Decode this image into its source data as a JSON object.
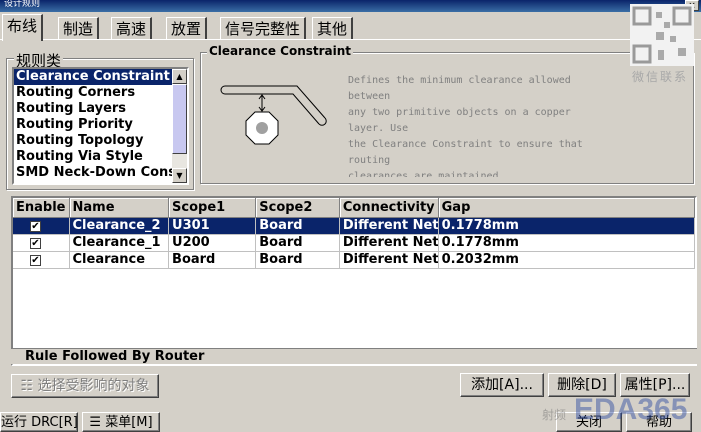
{
  "window": {
    "title": "设计规则"
  },
  "tabs": [
    {
      "label": "布线"
    },
    {
      "label": "制造"
    },
    {
      "label": "高速"
    },
    {
      "label": "放置"
    },
    {
      "label": "信号完整性"
    },
    {
      "label": "其他"
    }
  ],
  "rule_classes": {
    "title": "规则类",
    "items": [
      "Clearance Constraint",
      "Routing Corners",
      "Routing Layers",
      "Routing Priority",
      "Routing Topology",
      "Routing Via Style",
      "SMD Neck-Down Constraint"
    ],
    "selected_index": 0
  },
  "preview": {
    "title": "Clearance Constraint",
    "description": [
      "Defines the minimum clearance allowed",
      "between",
      "any two primitive objects on a copper",
      "layer. Use",
      "the Clearance Constraint to ensure that",
      "routing",
      "clearances are maintained"
    ]
  },
  "rules_table": {
    "columns": [
      "Enable",
      "Name",
      "Scope1",
      "Scope2",
      "Connectivity",
      "Gap"
    ],
    "rows": [
      {
        "enabled": true,
        "name": "Clearance_2",
        "scope1": "U301",
        "scope2": "Board",
        "connectivity": "Different Nets",
        "gap": "0.1778mm"
      },
      {
        "enabled": true,
        "name": "Clearance_1",
        "scope1": "U200",
        "scope2": "Board",
        "connectivity": "Different Nets",
        "gap": "0.1778mm"
      },
      {
        "enabled": true,
        "name": "Clearance",
        "scope1": "Board",
        "scope2": "Board",
        "connectivity": "Different Nets",
        "gap": "0.2032mm"
      }
    ],
    "selected_index": 0,
    "status_text": "Rule Followed By Router"
  },
  "buttons": {
    "select_objects": "选择受影响的对象",
    "add": "添加[A]...",
    "delete": "删除[D]",
    "properties": "属性[P]...",
    "run_drc": "运行 DRC[R]",
    "menu": "菜单[M]",
    "close": "关闭",
    "help": "帮助"
  },
  "watermarks": {
    "contact": "微信联系",
    "brand": "EDA365",
    "tagline": "射频"
  }
}
